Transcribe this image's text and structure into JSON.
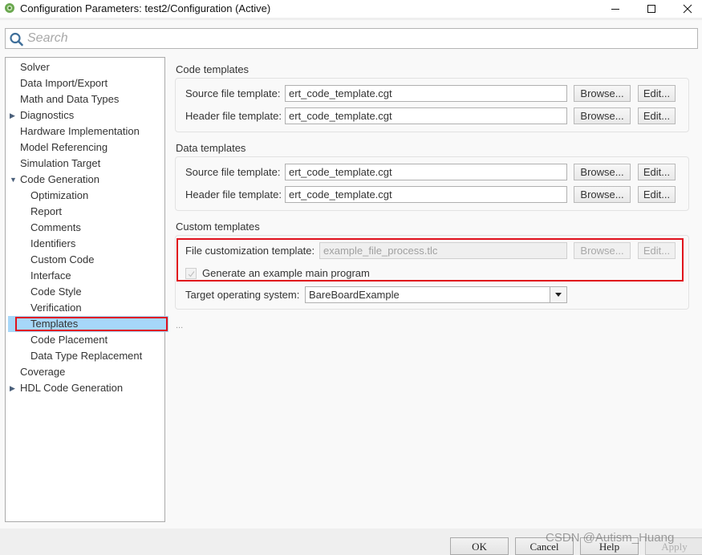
{
  "window": {
    "title": "Configuration Parameters: test2/Configuration (Active)",
    "icon": "simulink-gear-icon",
    "controls": [
      "minimize",
      "maximize",
      "close"
    ]
  },
  "search": {
    "placeholder": "Search",
    "value": ""
  },
  "tree": {
    "items": [
      {
        "label": "Solver",
        "level": 0,
        "expander": "none"
      },
      {
        "label": "Data Import/Export",
        "level": 0,
        "expander": "none"
      },
      {
        "label": "Math and Data Types",
        "level": 0,
        "expander": "none"
      },
      {
        "label": "Diagnostics",
        "level": 0,
        "expander": "collapsed"
      },
      {
        "label": "Hardware Implementation",
        "level": 0,
        "expander": "none"
      },
      {
        "label": "Model Referencing",
        "level": 0,
        "expander": "none"
      },
      {
        "label": "Simulation Target",
        "level": 0,
        "expander": "none"
      },
      {
        "label": "Code Generation",
        "level": 0,
        "expander": "expanded"
      },
      {
        "label": "Optimization",
        "level": 1,
        "expander": "none"
      },
      {
        "label": "Report",
        "level": 1,
        "expander": "none"
      },
      {
        "label": "Comments",
        "level": 1,
        "expander": "none"
      },
      {
        "label": "Identifiers",
        "level": 1,
        "expander": "none"
      },
      {
        "label": "Custom Code",
        "level": 1,
        "expander": "none"
      },
      {
        "label": "Interface",
        "level": 1,
        "expander": "none"
      },
      {
        "label": "Code Style",
        "level": 1,
        "expander": "none"
      },
      {
        "label": "Verification",
        "level": 1,
        "expander": "none"
      },
      {
        "label": "Templates",
        "level": 1,
        "expander": "none",
        "selected": true
      },
      {
        "label": "Code Placement",
        "level": 1,
        "expander": "none"
      },
      {
        "label": "Data Type Replacement",
        "level": 1,
        "expander": "none"
      },
      {
        "label": "Coverage",
        "level": 0,
        "expander": "none"
      },
      {
        "label": "HDL Code Generation",
        "level": 0,
        "expander": "collapsed"
      }
    ]
  },
  "code_templates": {
    "title": "Code templates",
    "source_label": "Source file template:",
    "source_value": "ert_code_template.cgt",
    "header_label": "Header file template:",
    "header_value": "ert_code_template.cgt"
  },
  "data_templates": {
    "title": "Data templates",
    "source_label": "Source file template:",
    "source_value": "ert_code_template.cgt",
    "header_label": "Header file template:",
    "header_value": "ert_code_template.cgt"
  },
  "custom_templates": {
    "title": "Custom templates",
    "file_customization_label": "File customization template:",
    "file_customization_value": "example_file_process.tlc",
    "generate_main_label": "Generate an example main program",
    "generate_main_checked": true,
    "generate_main_enabled": false,
    "target_os_label": "Target operating system:",
    "target_os_value": "BareBoardExample"
  },
  "buttons": {
    "browse": "Browse...",
    "edit": "Edit...",
    "ok": "OK",
    "cancel": "Cancel",
    "help": "Help",
    "apply": "Apply"
  },
  "ellipsis": "...",
  "watermark": "CSDN @Autism_Huang",
  "colors": {
    "selection": "#a6d7f9",
    "highlight_border": "#e0101c"
  }
}
